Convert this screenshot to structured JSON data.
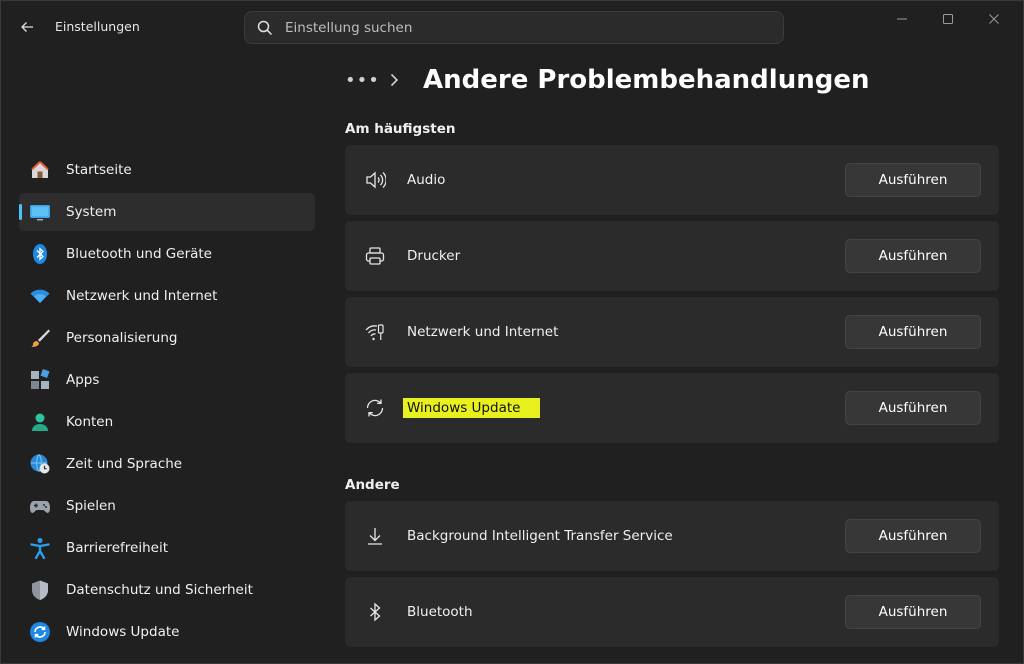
{
  "window": {
    "app_title": "Einstellungen"
  },
  "search": {
    "placeholder": "Einstellung suchen"
  },
  "breadcrumb": {
    "more": "•••",
    "title": "Andere Problembehandlungen"
  },
  "sidebar": {
    "items": [
      {
        "label": "Startseite",
        "icon": "home-icon"
      },
      {
        "label": "System",
        "icon": "monitor-icon",
        "active": true
      },
      {
        "label": "Bluetooth und Geräte",
        "icon": "bluetooth-icon"
      },
      {
        "label": "Netzwerk und Internet",
        "icon": "wifi-icon"
      },
      {
        "label": "Personalisierung",
        "icon": "brush-icon"
      },
      {
        "label": "Apps",
        "icon": "apps-icon"
      },
      {
        "label": "Konten",
        "icon": "person-icon"
      },
      {
        "label": "Zeit und Sprache",
        "icon": "globe-clock-icon"
      },
      {
        "label": "Spielen",
        "icon": "gamepad-icon"
      },
      {
        "label": "Barrierefreiheit",
        "icon": "accessibility-icon"
      },
      {
        "label": "Datenschutz und Sicherheit",
        "icon": "shield-icon"
      },
      {
        "label": "Windows Update",
        "icon": "update-icon"
      }
    ]
  },
  "sections": [
    {
      "title": "Am häufigsten",
      "items": [
        {
          "label": "Audio",
          "button": "Ausführen",
          "icon": "speaker-icon"
        },
        {
          "label": "Drucker",
          "button": "Ausführen",
          "icon": "printer-icon"
        },
        {
          "label": "Netzwerk und Internet",
          "button": "Ausführen",
          "icon": "network-icon"
        },
        {
          "label": "Windows Update",
          "button": "Ausführen",
          "icon": "refresh-icon",
          "highlighted": true
        }
      ]
    },
    {
      "title": "Andere",
      "items": [
        {
          "label": "Background Intelligent Transfer Service",
          "button": "Ausführen",
          "icon": "download-icon"
        },
        {
          "label": "Bluetooth",
          "button": "Ausführen",
          "icon": "bluetooth-icon"
        }
      ]
    }
  ],
  "colors": {
    "accent": "#4cc2ff",
    "highlight": "#e8f01e",
    "card": "#2b2b2b",
    "background": "#202020"
  }
}
